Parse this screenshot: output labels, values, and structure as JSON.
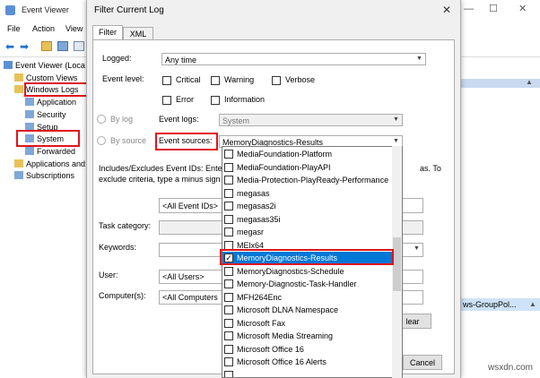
{
  "event_viewer": {
    "title": "Event Viewer",
    "menu": [
      "File",
      "Action",
      "View"
    ],
    "tree": [
      {
        "label": "Event Viewer (Loca",
        "indent": 0
      },
      {
        "label": "Custom Views",
        "indent": 1
      },
      {
        "label": "Windows Logs",
        "indent": 1
      },
      {
        "label": "Application",
        "indent": 2
      },
      {
        "label": "Security",
        "indent": 2
      },
      {
        "label": "Setup",
        "indent": 2
      },
      {
        "label": "System",
        "indent": 2
      },
      {
        "label": "Forwarded",
        "indent": 2
      },
      {
        "label": "Applications and",
        "indent": 1
      },
      {
        "label": "Subscriptions",
        "indent": 1
      }
    ],
    "right_pane_row": "ws-GroupPol..."
  },
  "dialog": {
    "title": "Filter Current Log",
    "close": "✕",
    "tabs": [
      "Filter",
      "XML"
    ],
    "logged_label": "Logged:",
    "logged_value": "Any time",
    "event_level_label": "Event level:",
    "levels": [
      "Critical",
      "Warning",
      "Verbose",
      "Error",
      "Information"
    ],
    "by_log_label": "By log",
    "by_source_label": "By source",
    "event_logs_label": "Event logs:",
    "event_logs_value": "System",
    "event_sources_label": "Event sources:",
    "event_sources_value": "MemoryDiagnostics-Results",
    "includes_line1": "Includes/Excludes Event IDs: Ente",
    "includes_line1_end": "as. To",
    "includes_line2": "exclude criteria, type a minus sign",
    "event_ids_placeholder": "<All Event IDs>",
    "task_category_label": "Task category:",
    "keywords_label": "Keywords:",
    "user_label": "User:",
    "user_value": "<All Users>",
    "computers_label": "Computer(s):",
    "computers_value": "<All Computers",
    "clear_btn": "lear",
    "cancel_btn": "Cancel"
  },
  "source_list": [
    {
      "label": "MediaFoundation-Platform",
      "checked": false,
      "selected": false
    },
    {
      "label": "MediaFoundation-PlayAPI",
      "checked": false,
      "selected": false
    },
    {
      "label": "Media-Protection-PlayReady-Performance",
      "checked": false,
      "selected": false
    },
    {
      "label": "megasas",
      "checked": false,
      "selected": false
    },
    {
      "label": "megasas2i",
      "checked": false,
      "selected": false
    },
    {
      "label": "megasas35i",
      "checked": false,
      "selected": false
    },
    {
      "label": "megasr",
      "checked": false,
      "selected": false
    },
    {
      "label": "MElx64",
      "checked": false,
      "selected": false
    },
    {
      "label": "MemoryDiagnostics-Results",
      "checked": true,
      "selected": true
    },
    {
      "label": "MemoryDiagnostics-Schedule",
      "checked": false,
      "selected": false
    },
    {
      "label": "Memory-Diagnostic-Task-Handler",
      "checked": false,
      "selected": false
    },
    {
      "label": "MFH264Enc",
      "checked": false,
      "selected": false
    },
    {
      "label": "Microsoft DLNA Namespace",
      "checked": false,
      "selected": false
    },
    {
      "label": "Microsoft Fax",
      "checked": false,
      "selected": false
    },
    {
      "label": "Microsoft Media Streaming",
      "checked": false,
      "selected": false
    },
    {
      "label": "Microsoft Office 16",
      "checked": false,
      "selected": false
    },
    {
      "label": "Microsoft Office 16 Alerts",
      "checked": false,
      "selected": false
    },
    {
      "label": "",
      "checked": false,
      "selected": false
    }
  ],
  "watermark": "wsxdn.com",
  "colors": {
    "highlight": "#0078d7",
    "annotation": "#e0131c"
  }
}
